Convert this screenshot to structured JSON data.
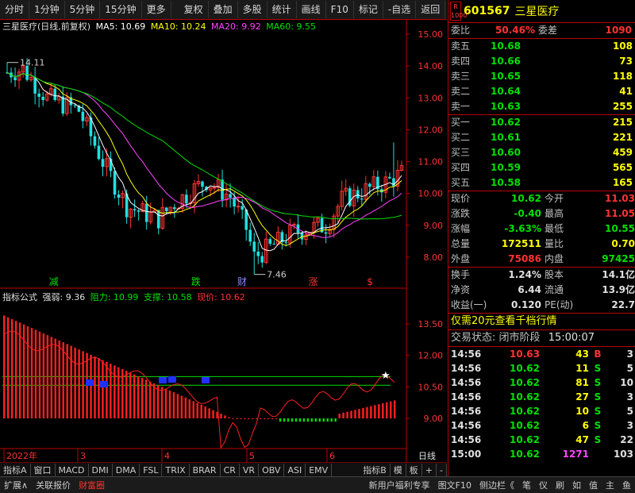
{
  "toolbar": {
    "left": [
      "分时",
      "1分钟",
      "5分钟",
      "15分钟",
      "更多"
    ],
    "right": [
      "复权",
      "叠加",
      "多股",
      "统计",
      "画线",
      "F10",
      "标记",
      "-自选",
      "返回"
    ]
  },
  "chart": {
    "title": "三星医疗(日线,前复权)",
    "ma": [
      {
        "label": "MA5: 10.69",
        "color": "#ffffff"
      },
      {
        "label": "MA10: 10.24",
        "color": "#ffff00"
      },
      {
        "label": "MA20: 9.92",
        "color": "#ff44ff"
      },
      {
        "label": "MA60: 9.55",
        "color": "#00e000"
      }
    ],
    "y_ticks": [
      "15.00",
      "14.00",
      "13.00",
      "12.00",
      "11.00",
      "10.00",
      "9.00",
      "8.00"
    ],
    "high_label": "14.11",
    "low_label": "7.46",
    "markers": [
      {
        "text": "减",
        "color": "#00e000"
      },
      {
        "text": "跌",
        "color": "#00e000"
      },
      {
        "text": "财",
        "color": "#8888ff"
      },
      {
        "text": "涨",
        "color": "#ff3232"
      },
      {
        "text": "$",
        "color": "#ff3232"
      }
    ],
    "x_labels": [
      "2022年",
      "3",
      "4",
      "5",
      "6"
    ],
    "x_right": "日线"
  },
  "indicator": {
    "name": "指标公式",
    "strength": "强弱: 9.36",
    "resistance": "阻力: 10.99",
    "support": "支撑: 10.58",
    "price": "现价: 10.62",
    "y_ticks": [
      "13.50",
      "12.00",
      "10.50",
      "9.00"
    ]
  },
  "tabs": [
    "指标A",
    "窗口",
    "MACD",
    "DMI",
    "DMA",
    "FSL",
    "TRIX",
    "BRAR",
    "CR",
    "VR",
    "OBV",
    "ASI",
    "EMV",
    "指标B",
    "模",
    "板",
    "+",
    "-"
  ],
  "status": [
    "扩展∧",
    "关联报价",
    "财富圈"
  ],
  "status_right": [
    "新用户福利专享",
    "图文F10",
    "侧边栏《",
    "笔",
    "仪",
    "刷",
    "如",
    "值",
    "主",
    "鱼"
  ],
  "quote": {
    "code": "601567",
    "name": "三星医疗",
    "logo": "R 1000",
    "weibi_label": "委比",
    "weibi_value": "50.46%",
    "weicha_label": "委差",
    "weicha_value": "1090",
    "asks": [
      {
        "label": "卖五",
        "price": "10.68",
        "vol": "108"
      },
      {
        "label": "卖四",
        "price": "10.66",
        "vol": "73"
      },
      {
        "label": "卖三",
        "price": "10.65",
        "vol": "118"
      },
      {
        "label": "卖二",
        "price": "10.64",
        "vol": "41"
      },
      {
        "label": "卖一",
        "price": "10.63",
        "vol": "255"
      }
    ],
    "bids": [
      {
        "label": "买一",
        "price": "10.62",
        "vol": "215"
      },
      {
        "label": "买二",
        "price": "10.61",
        "vol": "221"
      },
      {
        "label": "买三",
        "price": "10.60",
        "vol": "459"
      },
      {
        "label": "买四",
        "price": "10.59",
        "vol": "565"
      },
      {
        "label": "买五",
        "price": "10.58",
        "vol": "165"
      }
    ],
    "stats1": [
      {
        "l1": "现价",
        "v1": "10.62",
        "c1": "green",
        "l2": "今开",
        "v2": "11.03",
        "c2": "red"
      },
      {
        "l1": "涨跌",
        "v1": "-0.40",
        "c1": "green",
        "l2": "最高",
        "v2": "11.05",
        "c2": "red"
      },
      {
        "l1": "涨幅",
        "v1": "-3.63%",
        "c1": "green",
        "l2": "最低",
        "v2": "10.55",
        "c2": "green"
      },
      {
        "l1": "总量",
        "v1": "172511",
        "c1": "yellow",
        "l2": "量比",
        "v2": "0.70",
        "c2": "yellow"
      },
      {
        "l1": "外盘",
        "v1": "75086",
        "c1": "red",
        "l2": "内盘",
        "v2": "97425",
        "c2": "green"
      }
    ],
    "stats2": [
      {
        "l1": "换手",
        "v1": "1.24%",
        "l2": "股本",
        "v2": "14.1亿"
      },
      {
        "l1": "净资",
        "v1": "6.44",
        "l2": "流通",
        "v2": "13.9亿"
      },
      {
        "l1": "收益(一)",
        "v1": "0.120",
        "l2": "PE(动)",
        "v2": "22.7"
      }
    ],
    "promo": "仅需20元查看千档行情",
    "trade_label": "交易状态:",
    "trade_state": "闭市阶段",
    "trade_time": "15:00:07",
    "ticks": [
      {
        "t": "14:56",
        "p": "10.63",
        "pc": "red",
        "v": "43",
        "f": "B",
        "fc": "red",
        "n": "3"
      },
      {
        "t": "14:56",
        "p": "10.62",
        "pc": "green",
        "v": "11",
        "f": "S",
        "fc": "green",
        "n": "5"
      },
      {
        "t": "14:56",
        "p": "10.62",
        "pc": "green",
        "v": "81",
        "f": "S",
        "fc": "green",
        "n": "10"
      },
      {
        "t": "14:56",
        "p": "10.62",
        "pc": "green",
        "v": "27",
        "f": "S",
        "fc": "green",
        "n": "3"
      },
      {
        "t": "14:56",
        "p": "10.62",
        "pc": "green",
        "v": "10",
        "f": "S",
        "fc": "green",
        "n": "5"
      },
      {
        "t": "14:56",
        "p": "10.62",
        "pc": "green",
        "v": "6",
        "f": "S",
        "fc": "green",
        "n": "3"
      },
      {
        "t": "14:56",
        "p": "10.62",
        "pc": "green",
        "v": "47",
        "f": "S",
        "fc": "green",
        "n": "22"
      },
      {
        "t": "15:00",
        "p": "10.62",
        "pc": "green",
        "v": "1271",
        "f": "",
        "fc": "green",
        "n": "103"
      }
    ]
  }
}
